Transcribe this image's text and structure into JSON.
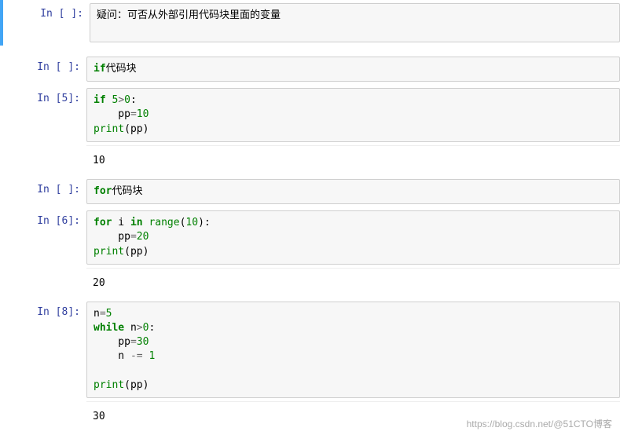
{
  "cells": [
    {
      "prompt": "In [ ]:",
      "type": "raw",
      "text": "疑问：可否从外部引用代码块里面的变量"
    },
    {
      "prompt": "In [ ]:",
      "type": "code",
      "tokens": [
        {
          "t": "if",
          "c": "kw"
        },
        {
          "t": "代码块",
          "c": ""
        }
      ]
    },
    {
      "prompt": "In [5]:",
      "type": "code",
      "lines": [
        [
          {
            "t": "if ",
            "c": "kw"
          },
          {
            "t": "5",
            "c": "num"
          },
          {
            "t": ">",
            "c": "op"
          },
          {
            "t": "0",
            "c": "num"
          },
          {
            "t": ":",
            "c": ""
          }
        ],
        [
          {
            "t": "    pp",
            "c": ""
          },
          {
            "t": "=",
            "c": "op"
          },
          {
            "t": "10",
            "c": "num"
          }
        ],
        [
          {
            "t": "print",
            "c": "builtin"
          },
          {
            "t": "(pp)",
            "c": ""
          }
        ]
      ],
      "output": "10"
    },
    {
      "prompt": "In [ ]:",
      "type": "code",
      "tokens": [
        {
          "t": "for",
          "c": "kw"
        },
        {
          "t": "代码块",
          "c": ""
        }
      ]
    },
    {
      "prompt": "In [6]:",
      "type": "code",
      "lines": [
        [
          {
            "t": "for",
            "c": "kw"
          },
          {
            "t": " i ",
            "c": ""
          },
          {
            "t": "in",
            "c": "kw"
          },
          {
            "t": " ",
            "c": ""
          },
          {
            "t": "range",
            "c": "builtin"
          },
          {
            "t": "(",
            "c": ""
          },
          {
            "t": "10",
            "c": "num"
          },
          {
            "t": "):",
            "c": ""
          }
        ],
        [
          {
            "t": "    pp",
            "c": ""
          },
          {
            "t": "=",
            "c": "op"
          },
          {
            "t": "20",
            "c": "num"
          }
        ],
        [
          {
            "t": "print",
            "c": "builtin"
          },
          {
            "t": "(pp)",
            "c": ""
          }
        ]
      ],
      "output": "20"
    },
    {
      "prompt": "In [8]:",
      "type": "code",
      "lines": [
        [
          {
            "t": "n",
            "c": ""
          },
          {
            "t": "=",
            "c": "op"
          },
          {
            "t": "5",
            "c": "num"
          }
        ],
        [
          {
            "t": "while",
            "c": "kw"
          },
          {
            "t": " n",
            "c": ""
          },
          {
            "t": ">",
            "c": "op"
          },
          {
            "t": "0",
            "c": "num"
          },
          {
            "t": ":",
            "c": ""
          }
        ],
        [
          {
            "t": "    pp",
            "c": ""
          },
          {
            "t": "=",
            "c": "op"
          },
          {
            "t": "30",
            "c": "num"
          }
        ],
        [
          {
            "t": "    n ",
            "c": ""
          },
          {
            "t": "-=",
            "c": "op"
          },
          {
            "t": " ",
            "c": ""
          },
          {
            "t": "1",
            "c": "num"
          }
        ],
        [
          {
            "t": "",
            "c": ""
          }
        ],
        [
          {
            "t": "print",
            "c": "builtin"
          },
          {
            "t": "(pp)",
            "c": ""
          }
        ]
      ],
      "output": "30"
    }
  ],
  "watermark": "https://blog.csdn.net/@51CTO博客"
}
